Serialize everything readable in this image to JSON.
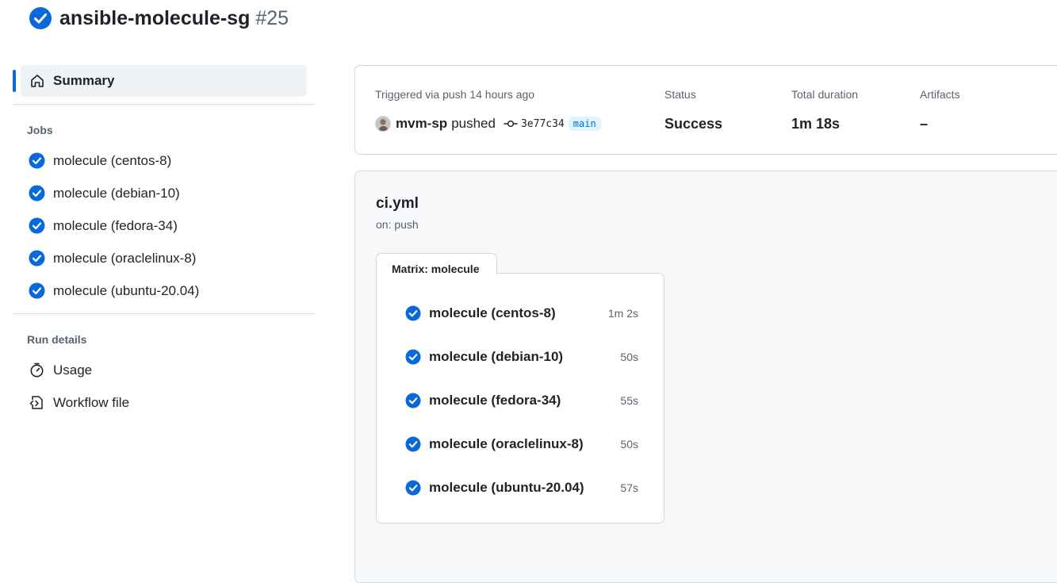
{
  "header": {
    "title": "ansible-molecule-sg",
    "run_number": "#25"
  },
  "sidebar": {
    "summary_label": "Summary",
    "jobs_heading": "Jobs",
    "jobs": [
      {
        "label": "molecule (centos-8)"
      },
      {
        "label": "molecule (debian-10)"
      },
      {
        "label": "molecule (fedora-34)"
      },
      {
        "label": "molecule (oraclelinux-8)"
      },
      {
        "label": "molecule (ubuntu-20.04)"
      }
    ],
    "run_details_heading": "Run details",
    "run_details": [
      {
        "label": "Usage",
        "icon": "stopwatch-icon"
      },
      {
        "label": "Workflow file",
        "icon": "file-code-icon"
      }
    ]
  },
  "summary": {
    "trigger_label": "Triggered via push 14 hours ago",
    "actor": "mvm-sp",
    "action": "pushed",
    "commit": "3e77c34",
    "branch": "main",
    "status_label": "Status",
    "status_value": "Success",
    "duration_label": "Total duration",
    "duration_value": "1m 18s",
    "artifacts_label": "Artifacts",
    "artifacts_value": "–"
  },
  "workflow": {
    "file": "ci.yml",
    "trigger": "on: push",
    "matrix_label": "Matrix: molecule",
    "jobs": [
      {
        "name": "molecule (centos-8)",
        "duration": "1m 2s"
      },
      {
        "name": "molecule (debian-10)",
        "duration": "50s"
      },
      {
        "name": "molecule (fedora-34)",
        "duration": "55s"
      },
      {
        "name": "molecule (oraclelinux-8)",
        "duration": "50s"
      },
      {
        "name": "molecule (ubuntu-20.04)",
        "duration": "57s"
      }
    ]
  },
  "colors": {
    "success": "#0969da",
    "accent": "#0969da",
    "muted_text": "#59636e",
    "border": "#d1d9e0",
    "panel_bg": "#f6f8fa"
  }
}
